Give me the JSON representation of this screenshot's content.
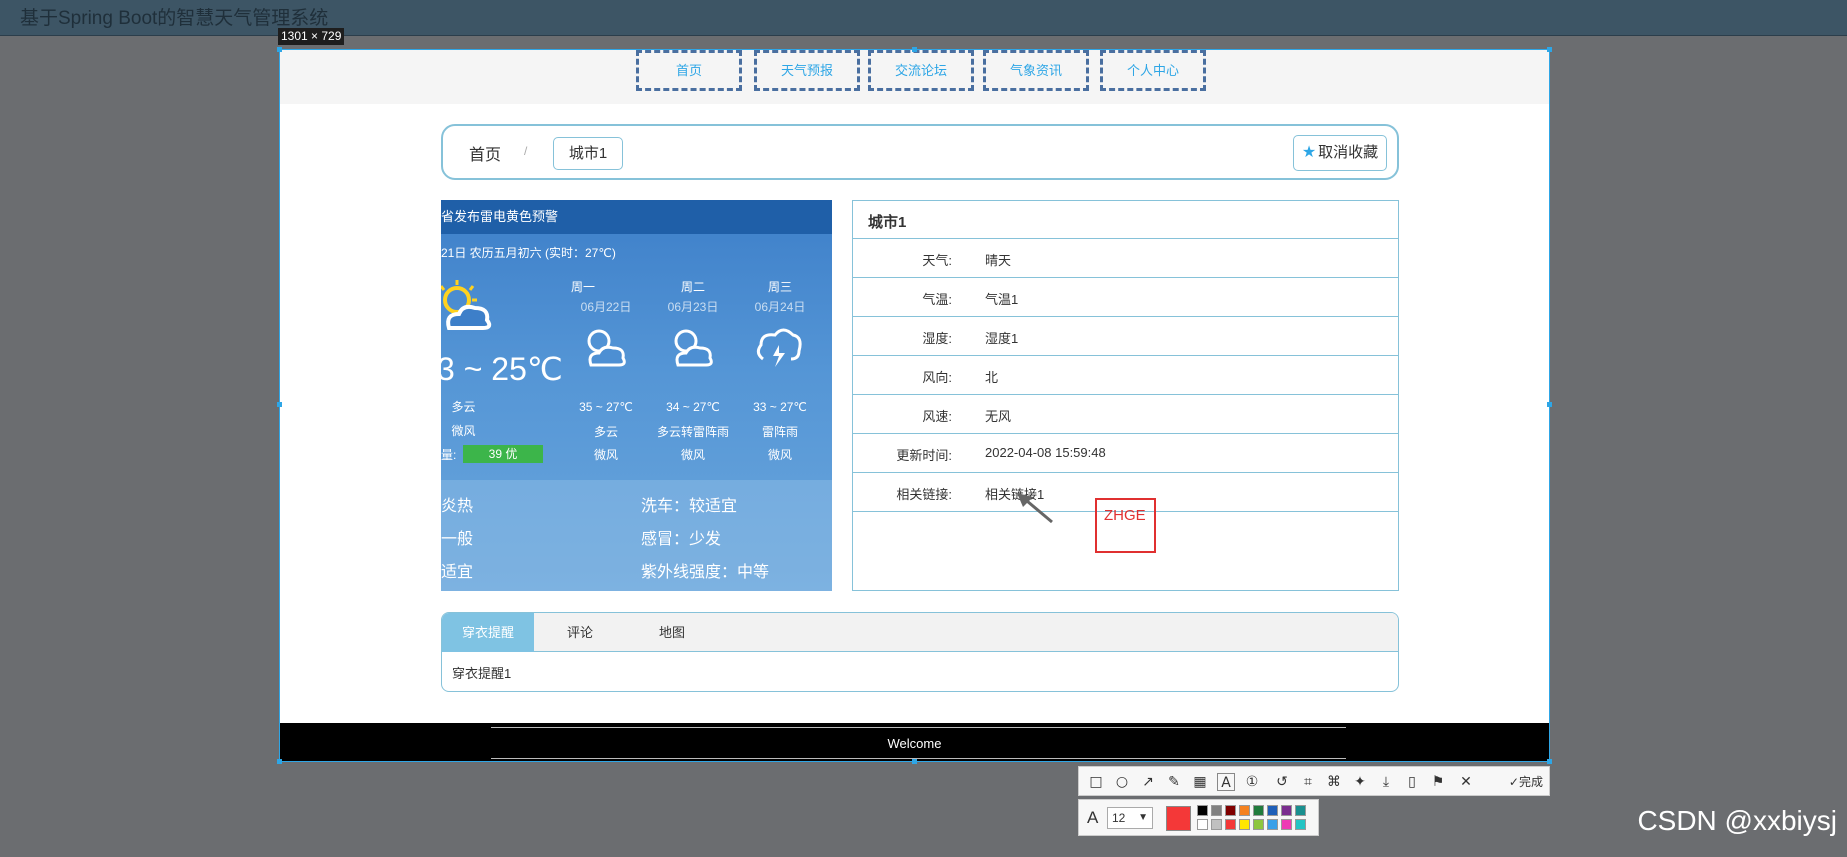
{
  "app": {
    "title": "基于Spring Boot的智慧天气管理系统",
    "size_label": "1301 × 729"
  },
  "nav": {
    "items": [
      "首页",
      "天气预报",
      "交流论坛",
      "气象资讯",
      "个人中心"
    ]
  },
  "breadcrumb": {
    "home": "首页",
    "separator": "/",
    "current": "城市1",
    "favorite_label": "取消收藏"
  },
  "weather_image": {
    "banner": "省发布雷电黄色预警",
    "subline": "21日 农历五月初六 (实时：27℃)",
    "today": {
      "temp": "3 ~ 25℃",
      "condition": "多云",
      "wind": "微风",
      "aqi_label": "量:",
      "aqi": "39 优"
    },
    "forecast": [
      {
        "day": "周一",
        "date": "06月22日",
        "temp": "35 ~ 27℃",
        "condition": "多云",
        "wind": "微风"
      },
      {
        "day": "周二",
        "date": "06月23日",
        "temp": "34 ~ 27℃",
        "condition": "多云转雷阵雨",
        "wind": "微风"
      },
      {
        "day": "周三",
        "date": "06月24日",
        "temp": "33 ~ 27℃",
        "condition": "雷阵雨",
        "wind": "微风"
      }
    ],
    "life_left": [
      "炎热",
      "一般",
      "适宜"
    ],
    "life_right": [
      "洗车：较适宜",
      "感冒：少发",
      "紫外线强度：中等"
    ]
  },
  "info": {
    "title": "城市1",
    "rows": [
      {
        "label": "天气:",
        "value": "晴天"
      },
      {
        "label": "气温:",
        "value": "气温1"
      },
      {
        "label": "湿度:",
        "value": "湿度1"
      },
      {
        "label": "风向:",
        "value": "北"
      },
      {
        "label": "风速:",
        "value": "无风"
      },
      {
        "label": "更新时间:",
        "value": "2022-04-08 15:59:48"
      },
      {
        "label": "相关链接:",
        "value": "相关链接1"
      }
    ]
  },
  "annotation": {
    "text": "ZHGE",
    "color": "#e03030"
  },
  "tabs": {
    "items": [
      "穿衣提醒",
      "评论",
      "地图"
    ],
    "content": "穿衣提醒1"
  },
  "footer": {
    "text": "Welcome"
  },
  "screenshot_toolbar": {
    "tools": [
      "rectangle-icon",
      "ellipse-icon",
      "arrow-icon",
      "pencil-icon",
      "mosaic-icon",
      "text-icon",
      "serial-number-icon",
      "undo-icon",
      "ocr-icon",
      "translate-icon",
      "pin-icon",
      "download-icon",
      "save-icon",
      "bookmark-icon",
      "close-icon"
    ],
    "done_label": "完成",
    "font_label": "A",
    "font_size": "12",
    "selected_color": "#f43838",
    "palette_top": [
      "#000000",
      "#808080",
      "#800000",
      "#f58220",
      "#217b3c",
      "#1f5fb8",
      "#7a2d8f",
      "#1a8f8f"
    ],
    "palette_bottom": [
      "#ffffff",
      "#c0c0c0",
      "#f43838",
      "#ffe600",
      "#8dc63f",
      "#3aa0e8",
      "#ee3ab4",
      "#23c4c4"
    ]
  },
  "watermark": "CSDN @xxbiysj"
}
